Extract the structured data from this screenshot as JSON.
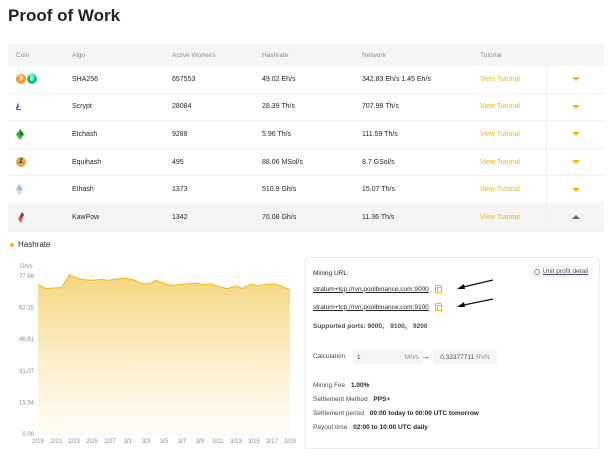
{
  "page_title": "Proof of Work",
  "table": {
    "headers": {
      "coin": "Coin",
      "algo": "Algo",
      "workers": "Active Workers",
      "hashrate": "Hashrate",
      "network": "Network",
      "tutorial": "Tutorial"
    },
    "rows": [
      {
        "coin_icons": [
          "btc-icon",
          "bch-icon"
        ],
        "algo": "SHA256",
        "workers": "657553",
        "hashrate": "49.02 Eh/s",
        "network": "342.83 Eh/s 1.45 Eh/s",
        "tutorial": "View Tutorial",
        "expanded": false
      },
      {
        "coin_icons": [
          "ltc-icon"
        ],
        "algo": "Scrypt",
        "workers": "28084",
        "hashrate": "28.39 Th/s",
        "network": "707.98 Th/s",
        "tutorial": "View Tutorial",
        "expanded": false
      },
      {
        "coin_icons": [
          "etc-icon"
        ],
        "algo": "Etchash",
        "workers": "9288",
        "hashrate": "5.96 Th/s",
        "network": "111.59 Th/s",
        "tutorial": "View Tutorial",
        "expanded": false
      },
      {
        "coin_icons": [
          "zec-icon"
        ],
        "algo": "Equihash",
        "workers": "495",
        "hashrate": "88.06 MSol/s",
        "network": "8.7 GSol/s",
        "tutorial": "View Tutorial",
        "expanded": false
      },
      {
        "coin_icons": [
          "eth-icon"
        ],
        "algo": "Ethash",
        "workers": "1373",
        "hashrate": "510.9 Gh/s",
        "network": "15.07 Th/s",
        "tutorial": "View Tutorial",
        "expanded": false
      },
      {
        "coin_icons": [
          "rvn-icon"
        ],
        "algo": "KawPow",
        "workers": "1342",
        "hashrate": "70.08 Gh/s",
        "network": "11.36 Th/s",
        "tutorial": "View Tutorial",
        "expanded": true
      }
    ]
  },
  "hashrate_section": {
    "title": "Hashrate"
  },
  "chart_data": {
    "type": "area",
    "ylabel": "Gh/s",
    "yticks": [
      "0.00",
      "15.54",
      "31.07",
      "46.61",
      "62.15",
      "77.68"
    ],
    "ylim": [
      0,
      77.68
    ],
    "xticks": [
      "2/19",
      "2/21",
      "2/23",
      "2/25",
      "2/27",
      "3/1",
      "3/3",
      "3/5",
      "3/7",
      "3/9",
      "3/11",
      "3/13",
      "3/15",
      "3/17",
      "3/19"
    ],
    "grid": true,
    "color": "#f0b90b",
    "series": [
      {
        "values": [
          73.5,
          71.5,
          71.8,
          72.0,
          78.2,
          76.5,
          75.8,
          75.5,
          76.0,
          75.6,
          76.2,
          76.5,
          76.0,
          74.2,
          73.8,
          75.5,
          74.0,
          73.0,
          73.5,
          73.8,
          74.2,
          73.4,
          73.8,
          72.4,
          71.5,
          72.6,
          71.6,
          73.6,
          72.8,
          73.6,
          73.8,
          72.6,
          70.9
        ]
      }
    ]
  },
  "mining": {
    "url_label": "Mining URL:",
    "unit_profit_label": "Unit profit detail",
    "urls": [
      "stratum+tcp://rvn.poolbinance.com:9000",
      "stratum+tcp://rvn.poolbinance.com:9100"
    ],
    "ports_label": "Supported ports: 9000、 9100、 9200",
    "calc_label": "Calculation",
    "calc_value": "1",
    "calc_unit": "Mh/s",
    "calc_result_value": "0.33377711",
    "calc_result_unit": "RVN",
    "fee_label": "Mining Fee",
    "fee_value": "1.00%",
    "settlement_method_label": "Settlement Method",
    "settlement_method_value": "PPS+",
    "settlement_period_label": "Settlement period",
    "settlement_period_value": "00:00 today to 00:00 UTC tomorrow",
    "payout_label": "Payout time",
    "payout_value": "02:00 to 10:00 UTC daily"
  }
}
